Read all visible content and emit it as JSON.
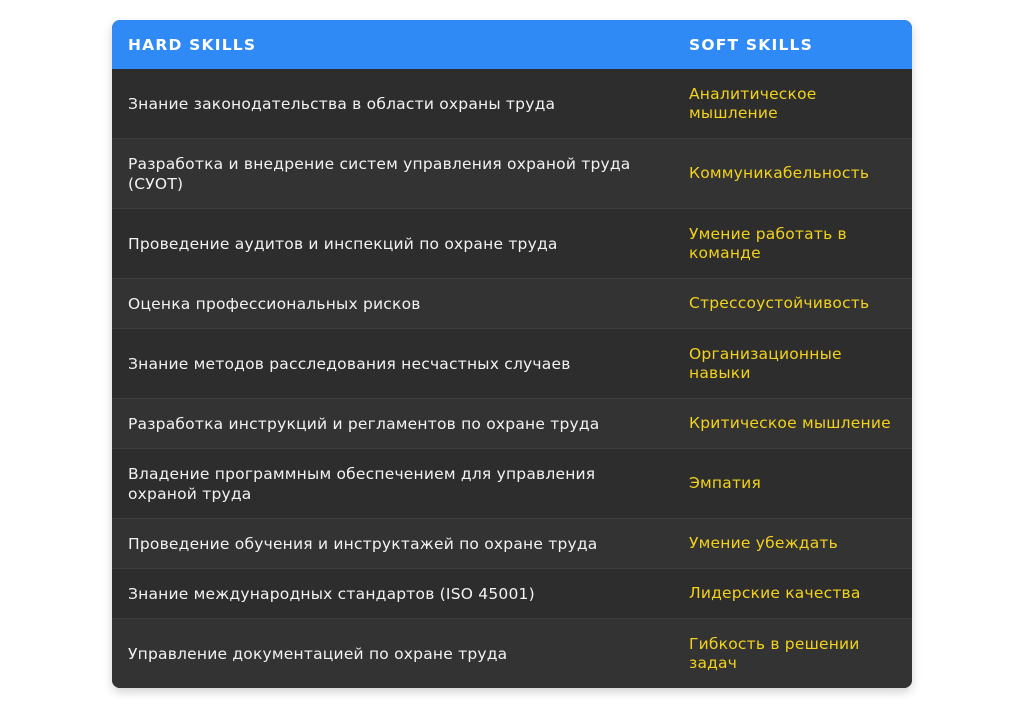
{
  "table": {
    "header": {
      "hard": "HARD SKILLS",
      "soft": "SOFT SKILLS"
    },
    "rows": [
      {
        "hard": "Знание законодательства в области охраны труда",
        "soft": "Аналитическое мышление"
      },
      {
        "hard": "Разработка и внедрение систем управления охраной труда (СУОТ)",
        "soft": "Коммуникабельность"
      },
      {
        "hard": "Проведение аудитов и инспекций по охране труда",
        "soft": "Умение работать в команде"
      },
      {
        "hard": "Оценка профессиональных рисков",
        "soft": "Стрессоустойчивость"
      },
      {
        "hard": "Знание методов расследования несчастных случаев",
        "soft": "Организационные навыки"
      },
      {
        "hard": "Разработка инструкций и регламентов по охране труда",
        "soft": "Критическое мышление"
      },
      {
        "hard": "Владение программным обеспечением для управления охраной труда",
        "soft": "Эмпатия"
      },
      {
        "hard": "Проведение обучения и инструктажей по охране труда",
        "soft": "Умение убеждать"
      },
      {
        "hard": "Знание международных стандартов (ISO 45001)",
        "soft": "Лидерские качества"
      },
      {
        "hard": "Управление документацией по охране труда",
        "soft": "Гибкость в решении задач"
      }
    ]
  },
  "colors": {
    "header_bg": "#2f8af5",
    "row_bg": "#2d2d2d",
    "hard_text": "#f2f2f2",
    "soft_text": "#f2d21c"
  }
}
